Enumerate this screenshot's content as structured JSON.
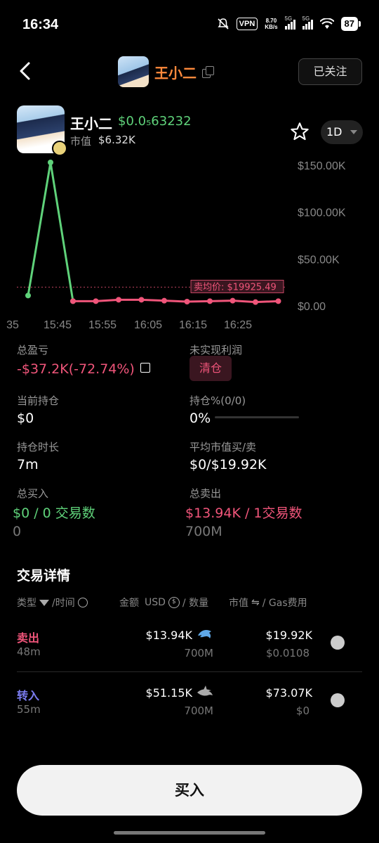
{
  "status_bar": {
    "time": "16:34",
    "vpn": "VPN",
    "speed": "8.70",
    "speed_unit": "KB/s",
    "net1": "5G",
    "net2": "5G",
    "battery": "87"
  },
  "header": {
    "title": "王小二",
    "follow_label": "已关注"
  },
  "token": {
    "name": "王小二",
    "price": "$0.0₅63232",
    "mcap_label": "市值",
    "mcap": "$6.32K",
    "timeframe": "1D"
  },
  "chart_data": {
    "type": "line",
    "x_ticks": [
      "35",
      "15:45",
      "15:55",
      "16:05",
      "16:15",
      "16:25"
    ],
    "y_ticks": [
      "$150.00K",
      "$100.00K",
      "$50.00K",
      "$0.00"
    ],
    "ylim": [
      0,
      150000
    ],
    "series": [
      {
        "color": "#5fd27a",
        "values": [
          11000,
          153000,
          5000
        ]
      },
      {
        "color": "#f0557a",
        "values": [
          5000,
          5000,
          6500,
          6500,
          5500,
          4500,
          5000,
          5500,
          4000,
          5000
        ]
      }
    ],
    "avg_sell_label": "卖均价: $19925.49",
    "avg_sell_value": 19925.49
  },
  "stats": {
    "total_pnl_label": "总盈亏",
    "total_pnl": "-$37.2K(-72.74%)",
    "unrealized_label": "未实现利润",
    "clear_label": "清仓",
    "holding_label": "当前持仓",
    "holding": "$0",
    "holding_pct_label": "持仓%(0/0)",
    "holding_pct": "0%",
    "duration_label": "持仓时长",
    "duration": "7m",
    "avg_mc_label": "平均市值买/卖",
    "avg_mc": "$0/$19.92K",
    "total_buy_label": "总买入",
    "total_buy": "$0 / 0 交易数",
    "total_buy_qty": "0",
    "total_sell_label": "总卖出",
    "total_sell": "$13.94K / 1交易数",
    "total_sell_qty": "700M"
  },
  "trades": {
    "title": "交易详情",
    "col_type": "类型",
    "col_time": "/时间",
    "col_amount": "金额",
    "col_usd": "USD",
    "col_qty": "/ 数量",
    "col_mc": "市值",
    "col_gas": "/ Gas费用",
    "rows": [
      {
        "type": "卖出",
        "age": "48m",
        "amount": "$13.94K",
        "qty": "700M",
        "mc": "$19.92K",
        "gas": "$0.0108",
        "color": "#f0557a"
      },
      {
        "type": "转入",
        "age": "55m",
        "amount": "$51.15K",
        "qty": "700M",
        "mc": "$73.07K",
        "gas": "$0",
        "color": "#7b7cf0"
      }
    ]
  },
  "buy_label": "买入"
}
